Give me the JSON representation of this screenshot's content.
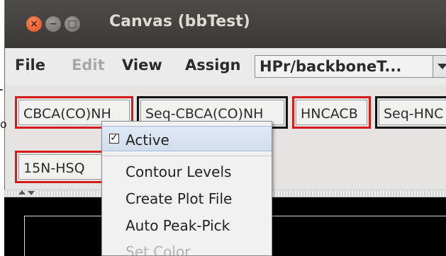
{
  "window": {
    "title": "Canvas (bbTest)"
  },
  "titlebar_buttons": {
    "close_glyph": "×",
    "min_glyph": "−",
    "max_glyph": "□"
  },
  "menubar": {
    "file": "File",
    "edit": "Edit",
    "view": "View",
    "assign": "Assign",
    "combo_value": "HPr/backboneT..."
  },
  "toolbar": {
    "tabs": [
      {
        "label": "CBCA(CO)NH",
        "active": true
      },
      {
        "label": "Seq-CBCA(CO)NH",
        "active": false
      },
      {
        "label": "HNCACB",
        "active": true
      },
      {
        "label": "Seq-HNC",
        "active": false
      },
      {
        "label": "15N-HSQ",
        "active": true
      }
    ]
  },
  "left_fragment": {
    "text": "o"
  },
  "context_menu": {
    "active_check": "✓",
    "items": [
      {
        "label": "Active",
        "checked": true,
        "enabled": true
      },
      {
        "label": "Contour Levels",
        "enabled": true
      },
      {
        "label": "Create Plot File",
        "enabled": true
      },
      {
        "label": "Auto Peak-Pick",
        "enabled": true
      },
      {
        "label": "Set Color",
        "enabled": false
      }
    ]
  },
  "colors": {
    "active_border": "#d21b1b",
    "inactive_border": "#111111",
    "titlebar": "#3f3e3a",
    "close_button": "#e2501b",
    "canvas_bg": "#000000"
  }
}
